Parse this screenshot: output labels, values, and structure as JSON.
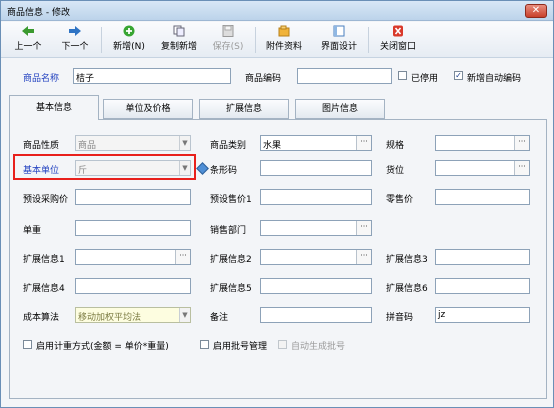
{
  "window": {
    "title": "商品信息 - 修改",
    "close": "✕"
  },
  "toolbar": {
    "prev": "上一个",
    "next": "下一个",
    "new": "新增(N)",
    "copy_new": "复制新增",
    "save": "保存(S)",
    "attachments": "附件资料",
    "interface_design": "界面设计",
    "close_window": "关闭窗口"
  },
  "header": {
    "name_label": "商品名称",
    "name_value": "桔子",
    "code_label": "商品编码",
    "code_value": "",
    "disabled_label": "已停用",
    "disabled_checked": false,
    "auto_code_label": "新增自动编码",
    "auto_code_checked": true
  },
  "tabs": [
    "基本信息",
    "单位及价格",
    "扩展信息",
    "图片信息"
  ],
  "form": {
    "nature_label": "商品性质",
    "nature_value": "商品",
    "category_label": "商品类别",
    "category_value": "水果",
    "spec_label": "规格",
    "spec_value": "",
    "base_unit_label": "基本单位",
    "base_unit_value": "斤",
    "barcode_label": "条形码",
    "barcode_value": "",
    "location_label": "货位",
    "location_value": "",
    "purchase_price_label": "预设采购价",
    "purchase_price_value": "",
    "sale_price_label": "预设售价1",
    "sale_price_value": "",
    "retail_price_label": "零售价",
    "retail_price_value": "",
    "weight_label": "单重",
    "weight_value": "",
    "dept_label": "销售部门",
    "dept_value": "",
    "ext1_label": "扩展信息1",
    "ext1_value": "",
    "ext2_label": "扩展信息2",
    "ext2_value": "",
    "ext3_label": "扩展信息3",
    "ext3_value": "",
    "ext4_label": "扩展信息4",
    "ext4_value": "",
    "ext5_label": "扩展信息5",
    "ext5_value": "",
    "ext6_label": "扩展信息6",
    "ext6_value": "",
    "cost_method_label": "成本算法",
    "cost_method_value": "移动加权平均法",
    "remark_label": "备注",
    "remark_value": "",
    "pinyin_label": "拼音码",
    "pinyin_value": "jz"
  },
  "footer": {
    "weigh_label": "启用计重方式(金额 = 单价*重量)",
    "batch_label": "启用批号管理",
    "auto_batch_label": "自动生成批号"
  },
  "colors": {
    "highlight": "#e8201c",
    "label_blue": "#1f3fbf"
  }
}
